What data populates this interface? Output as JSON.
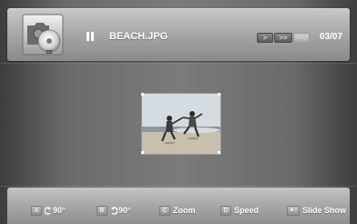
{
  "header": {
    "filename": "BEACH.JPG",
    "speed_buttons": [
      ">",
      ">>",
      ">>>"
    ],
    "counter": "03/07",
    "cd_label": "CD"
  },
  "footer": {
    "keys": [
      {
        "key": "A",
        "label": "90°",
        "icon": "rotate-left-icon"
      },
      {
        "key": "B",
        "label": "90°",
        "icon": "rotate-right-icon"
      },
      {
        "key": "C",
        "label": "Zoom"
      },
      {
        "key": "D",
        "label": "Speed"
      },
      {
        "key": "►I",
        "label": "Slide Show",
        "icon": "play-pause-icon"
      }
    ]
  },
  "photo": {
    "icon": "beach-photo-thumbnail"
  }
}
